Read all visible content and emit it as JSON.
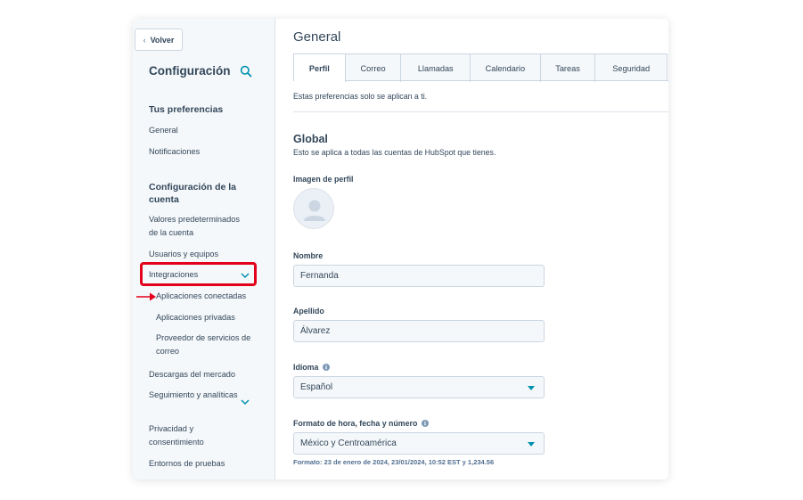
{
  "sidebar": {
    "back_label": "Volver",
    "title": "Configuración",
    "sections": [
      {
        "title": "Tus preferencias",
        "items": [
          "General",
          "Notificaciones"
        ]
      },
      {
        "title": "Configuración de la cuenta",
        "items": [
          "Valores predeterminados de la cuenta",
          "Usuarios y equipos",
          "Integraciones",
          "Aplicaciones conectadas",
          "Aplicaciones privadas",
          "Proveedor de servicios de correo",
          "Descargas del mercado",
          "Seguimiento y analíticas",
          "Privacidad y consentimiento",
          "Entornos de pruebas"
        ]
      }
    ]
  },
  "main": {
    "page_title": "General",
    "tabs": [
      "Perfil",
      "Correo",
      "Llamadas",
      "Calendario",
      "Tareas",
      "Seguridad"
    ],
    "active_tab": "Perfil",
    "pref_note": "Estas preferencias solo se aplican a ti.",
    "global_title": "Global",
    "global_desc": "Esto se aplica a todas las cuentas de HubSpot que tienes.",
    "profile_image_label": "Imagen de perfil",
    "first_name_label": "Nombre",
    "first_name_value": "Fernanda",
    "last_name_label": "Apellido",
    "last_name_value": "Álvarez",
    "language_label": "Idioma",
    "language_value": "Español",
    "format_label": "Formato de hora, fecha y número",
    "format_value": "México y Centroamérica",
    "format_hint": "Formato: 23 de enero de 2024, 23/01/2024, 10:52 EST y 1,234.56"
  },
  "colors": {
    "accent": "#0091ae",
    "highlight": "#e3001b",
    "text": "#33475b",
    "sidebar_bg": "#f5f8fa"
  },
  "icons": {
    "back": "chevron-left-icon",
    "search": "search-icon",
    "expand": "chevron-down-icon",
    "info": "info-icon",
    "avatar": "user-avatar-icon",
    "annotation": "red-arrow-icon"
  }
}
